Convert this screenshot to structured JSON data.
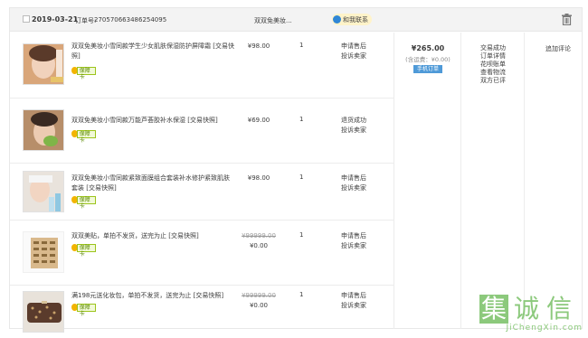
{
  "order": {
    "date": "2019-03-21",
    "order_no_label": "订单号:",
    "order_no": "270570663486254095",
    "shop_name": "双双免美妆...",
    "contact_label": "和我联系",
    "total": "¥265.00",
    "freight": "(含运费：¥0.00)",
    "pay_method": "手机订单",
    "status_links": [
      "交易成功",
      "订单详情",
      "花呗账单",
      "查看物流",
      "双方已评"
    ],
    "operation": "追加评论"
  },
  "items": [
    {
      "title": "双双免美妆小雪同款学生少女肌肤保湿防护屏障霜 [交易快照]",
      "badge": "保障卡",
      "price": "¥98.00",
      "orig_price": "",
      "qty": "1",
      "after_links": [
        "申请售后",
        "投诉卖家"
      ]
    },
    {
      "title": "双双免美妆小雪同款万能芦荟胶补水保湿 [交易快照]",
      "badge": "保障卡",
      "price": "¥69.00",
      "orig_price": "",
      "qty": "1",
      "after_links": [
        "退货成功",
        "投诉卖家"
      ]
    },
    {
      "title": "双双免美妆小雪同款紧致面膜组合套装补水修护紧致肌肤套装 [交易快照]",
      "badge": "保障卡",
      "price": "¥98.00",
      "orig_price": "",
      "qty": "1",
      "after_links": [
        "申请售后",
        "投诉卖家"
      ]
    },
    {
      "title": "双双美贴，单拍不发货，送完为止 [交易快照]",
      "badge": "保障卡",
      "price": "¥0.00",
      "orig_price": "¥99999.00",
      "qty": "1",
      "after_links": [
        "申请售后",
        "投诉卖家"
      ]
    },
    {
      "title": "满198元送化妆包，单拍不发货，送完为止 [交易快照]",
      "badge": "保障卡",
      "price": "¥0.00",
      "orig_price": "¥99999.00",
      "qty": "1",
      "after_links": [
        "申请售后",
        "投诉卖家"
      ]
    }
  ],
  "watermark": {
    "chars": [
      "集",
      "诚",
      "信"
    ],
    "url": "JiChengXin.com"
  },
  "colors": {
    "header_bg": "#f3f3f3",
    "contact_bg": "#fff3c9",
    "pay_tag": "#4f9ad8",
    "badge_border": "#9cc41b",
    "watermark": "#8cc97c"
  }
}
